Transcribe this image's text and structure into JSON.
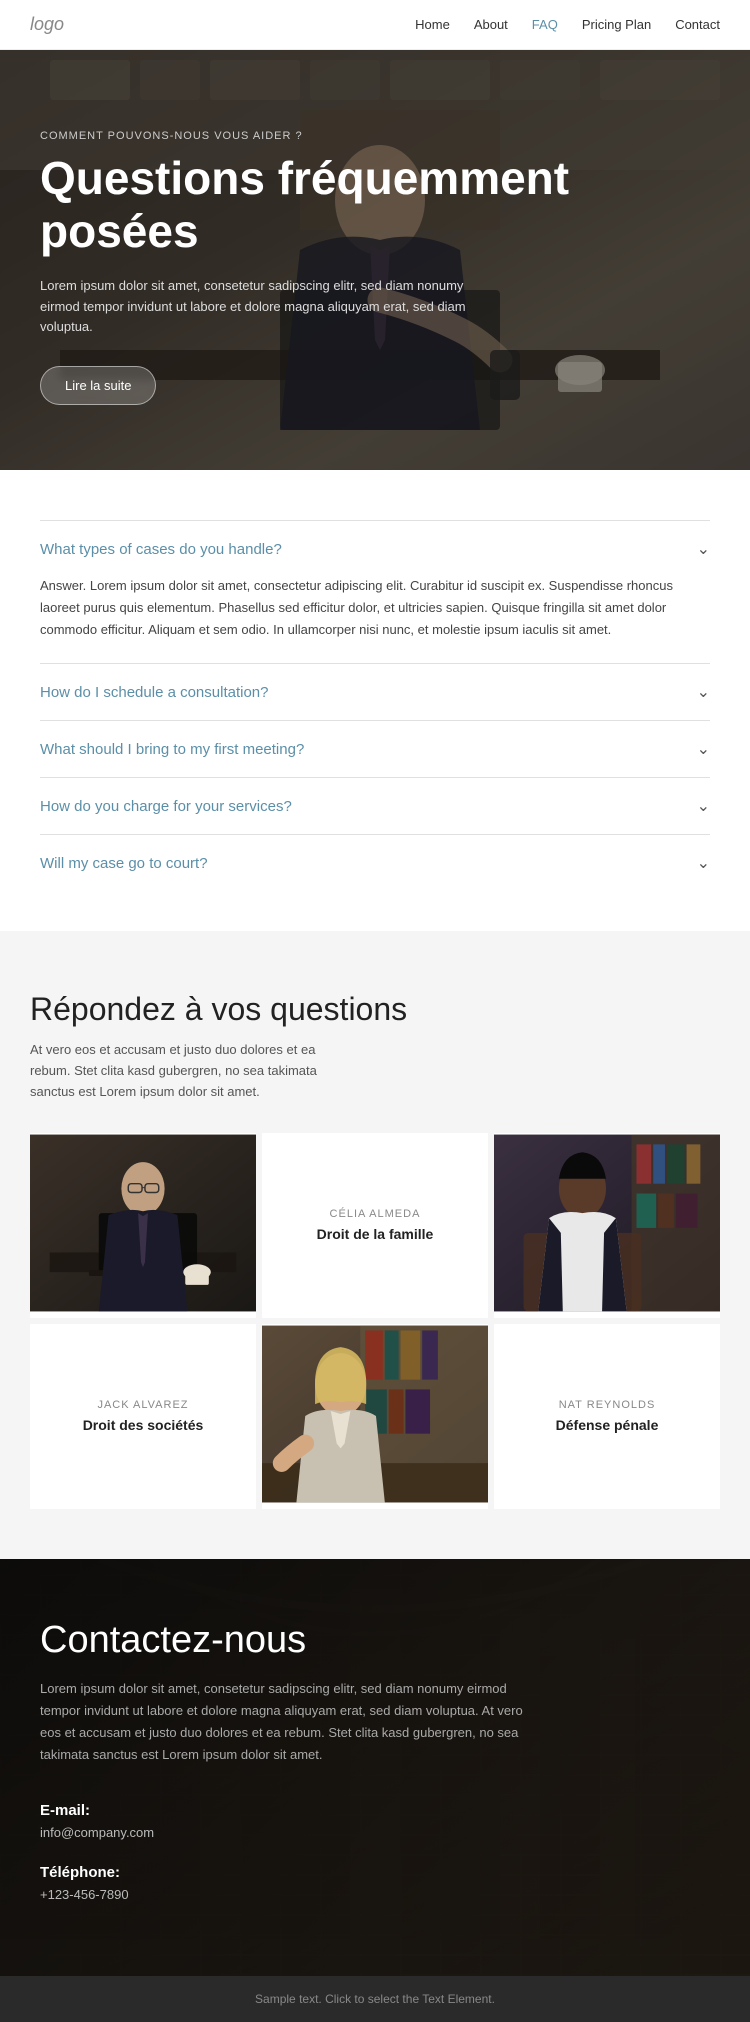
{
  "nav": {
    "logo": "logo",
    "links": [
      {
        "label": "Home",
        "active": false
      },
      {
        "label": "About",
        "active": false
      },
      {
        "label": "FAQ",
        "active": true
      },
      {
        "label": "Pricing Plan",
        "active": false
      },
      {
        "label": "Contact",
        "active": false
      }
    ]
  },
  "hero": {
    "subtitle": "COMMENT POUVONS-NOUS VOUS AIDER ?",
    "title": "Questions fréquemment posées",
    "description": "Lorem ipsum dolor sit amet, consetetur sadipscing elitr, sed diam nonumy eirmod tempor invidunt ut labore et dolore magna aliquyam erat, sed diam voluptua.",
    "button_label": "Lire la suite"
  },
  "faq": {
    "items": [
      {
        "question": "What types of cases do you handle?",
        "answer": "Answer. Lorem ipsum dolor sit amet, consectetur adipiscing elit. Curabitur id suscipit ex. Suspendisse rhoncus laoreet purus quis elementum. Phasellus sed efficitur dolor, et ultricies sapien. Quisque fringilla sit amet dolor commodo efficitur. Aliquam et sem odio. In ullamcorper nisi nunc, et molestie ipsum iaculis sit amet.",
        "open": true
      },
      {
        "question": "How do I schedule a consultation?",
        "answer": "",
        "open": false
      },
      {
        "question": "What should I bring to my first meeting?",
        "answer": "",
        "open": false
      },
      {
        "question": "How do you charge for your services?",
        "answer": "",
        "open": false
      },
      {
        "question": "Will my case go to court?",
        "answer": "",
        "open": false
      }
    ]
  },
  "team": {
    "title": "Répondez à vos questions",
    "description": "At vero eos et accusam et justo duo dolores et ea rebum. Stet clita kasd gubergren, no sea takimata sanctus est Lorem ipsum dolor sit amet.",
    "members": [
      {
        "name": "CÉLIA ALMEDA",
        "role": "Droit de la famille",
        "photo_type": "woman1",
        "has_photo": false
      },
      {
        "name": "JACK ALVAREZ",
        "role": "Droit des sociétés",
        "photo_type": "man1",
        "has_photo": false
      },
      {
        "name": "NAT REYNOLDS",
        "role": "Défense pénale",
        "photo_type": "woman1",
        "has_photo": false
      }
    ]
  },
  "contact": {
    "title": "Contactez-nous",
    "description": "Lorem ipsum dolor sit amet, consetetur sadipscing elitr, sed diam nonumy eirmod tempor invidunt ut labore et dolore magna aliquyam erat, sed diam voluptua. At vero eos et accusam et justo duo dolores et ea rebum. Stet clita kasd gubergren, no sea takimata sanctus est Lorem ipsum dolor sit amet.",
    "email_label": "E-mail:",
    "email_value": "info@company.com",
    "phone_label": "Téléphone:",
    "phone_value": "+123-456-7890"
  },
  "footer": {
    "text": "Sample text. Click to select the Text Element."
  }
}
